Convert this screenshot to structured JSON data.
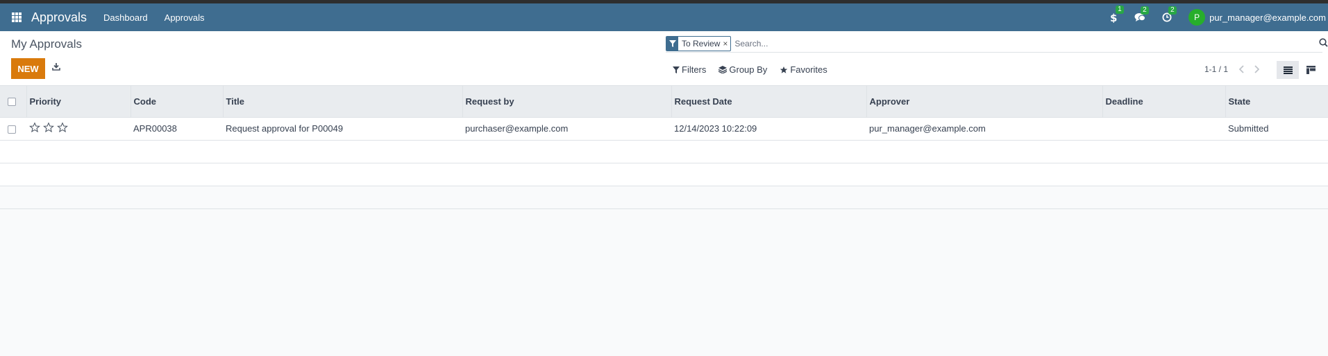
{
  "navbar": {
    "app_title": "Approvals",
    "links": [
      "Dashboard",
      "Approvals"
    ],
    "systray": [
      {
        "icon": "dollar-icon",
        "count": "1"
      },
      {
        "icon": "chat-icon",
        "count": "2"
      },
      {
        "icon": "clock-icon",
        "count": "2"
      }
    ],
    "user": {
      "initial": "P",
      "email": "pur_manager@example.com",
      "avatar_color": "#27ae2b"
    }
  },
  "control_panel": {
    "title": "My Approvals",
    "new_label": "NEW",
    "search": {
      "facet": "To Review",
      "facet_remove": "×",
      "placeholder": "Search..."
    },
    "filters_label": "Filters",
    "groupby_label": "Group By",
    "favorites_label": "Favorites",
    "pager": "1-1 / 1"
  },
  "table": {
    "headers": [
      "Priority",
      "Code",
      "Title",
      "Request by",
      "Request Date",
      "Approver",
      "Deadline",
      "State"
    ],
    "rows": [
      {
        "priority_stars": 0,
        "code": "APR00038",
        "title": "Request approval for P00049",
        "request_by": "purchaser@example.com",
        "request_date": "12/14/2023 10:22:09",
        "approver": "pur_manager@example.com",
        "deadline": "",
        "state": "Submitted"
      }
    ]
  },
  "colors": {
    "navbar": "#3f6d90",
    "primary_button": "#d97a0c",
    "badge": "#28a745"
  }
}
